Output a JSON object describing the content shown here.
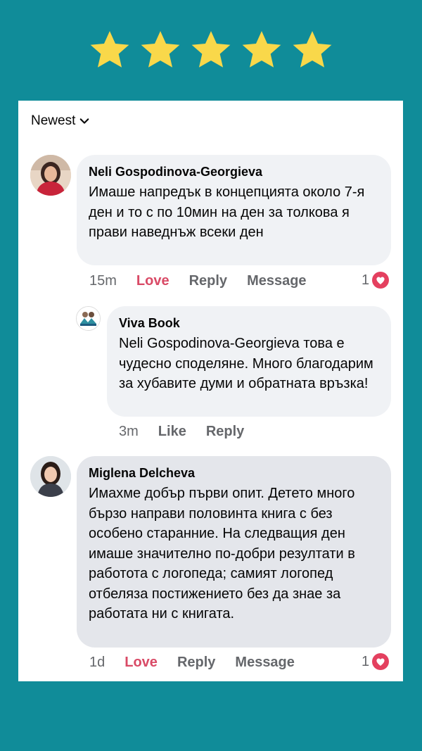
{
  "rating": {
    "stars": 5,
    "filled": 5,
    "star_color": "#f9d84a",
    "background": "#108c99"
  },
  "sort": {
    "label": "Newest",
    "icon": "chevron-down-icon"
  },
  "comments": [
    {
      "author": "Neli Gospodinova-Georgieva",
      "text": "Имаше  напредък в концепцията около  7-я ден и то  с по 10мин на ден за толкова я прави наведнъж всеки ден",
      "time": "15m",
      "reaction_label": "Love",
      "reply_label": "Reply",
      "message_label": "Message",
      "reaction_count": "1",
      "reaction_icon": "heart-icon"
    },
    {
      "author": "Viva Book",
      "text": "Neli Gospodinova-Georgieva това е чудесно споделяне. Много благодарим за хубавите думи и обратната връзка!",
      "time": "3m",
      "like_label": "Like",
      "reply_label": "Reply"
    },
    {
      "author": "Miglena Delcheva",
      "text": "Имахме добър първи опит. Детето много бързо направи половинта книга с без особено старанние. На следващия ден имаше значително по-добри резултати в работота с логопеда; самият логопед отбеляза постижението без да знае за работата ни с книгата.",
      "time": "1d",
      "reaction_label": "Love",
      "reply_label": "Reply",
      "message_label": "Message",
      "reaction_count": "1",
      "reaction_icon": "heart-icon"
    }
  ],
  "colors": {
    "love": "#d94a66",
    "muted": "#65676b",
    "bubble": "#f0f2f5",
    "bubble_active": "#e4e6eb"
  }
}
